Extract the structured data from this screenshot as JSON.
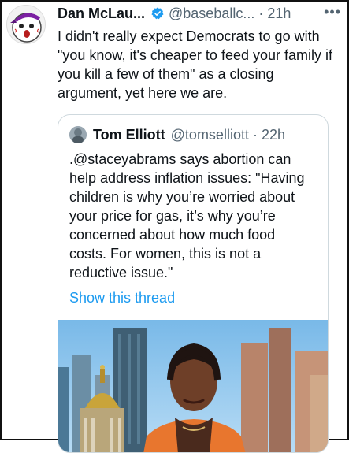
{
  "tweet": {
    "author_name": "Dan McLau...",
    "handle": "@baseballc...",
    "separator": "·",
    "time": "21h",
    "more_label": "•••",
    "text": "I didn't really expect Democrats to go with \"you know, it's cheaper to feed your family if you kill a few of them\" as a closing argument, yet here we are.",
    "avatar_icon": "baseball-cartoon-icon",
    "verified_icon": "verified-badge-icon",
    "accent_color": "#1d9bf0"
  },
  "quoted": {
    "author_name": "Tom Elliott",
    "handle": "@tomselliott",
    "separator": "·",
    "time": "22h",
    "text": ".@staceyabrams says abortion can help address inflation issues: \"Having children is why you’re worried about your price for gas, it’s why you’re concerned about how much food costs. For women, this is not a reductive issue.\"",
    "show_thread": "Show this thread",
    "avatar_icon": "user-avatar-icon",
    "image_icon": "city-skyline-photo"
  }
}
